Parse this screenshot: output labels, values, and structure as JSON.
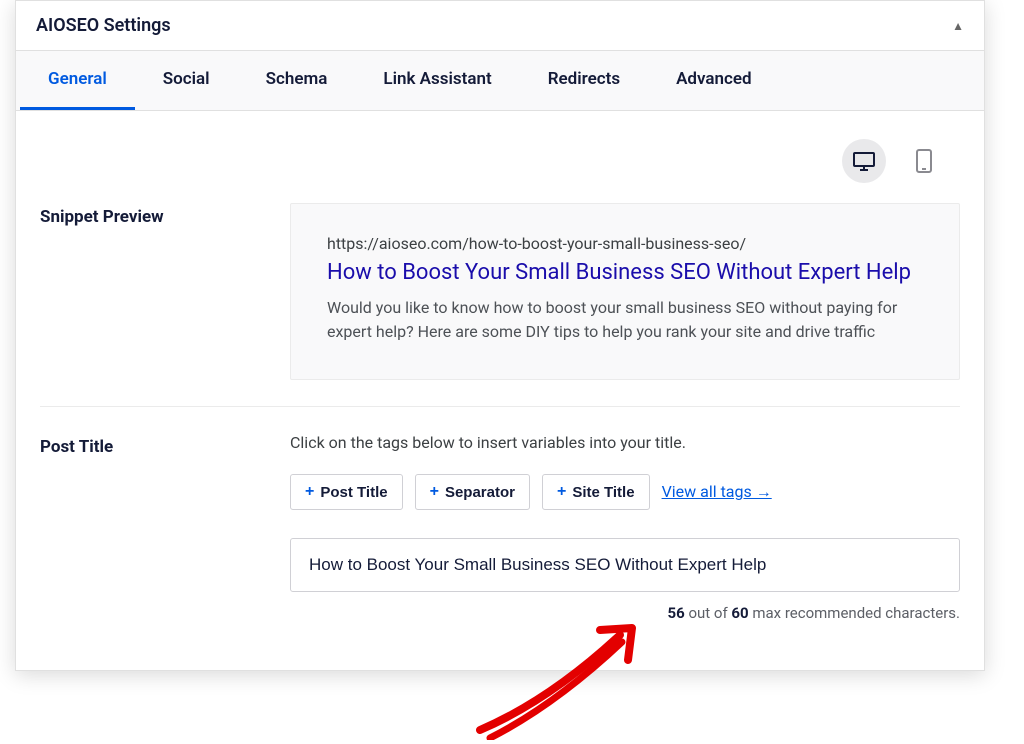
{
  "panel": {
    "title": "AIOSEO Settings"
  },
  "tabs": [
    {
      "label": "General",
      "active": true
    },
    {
      "label": "Social",
      "active": false
    },
    {
      "label": "Schema",
      "active": false
    },
    {
      "label": "Link Assistant",
      "active": false
    },
    {
      "label": "Redirects",
      "active": false
    },
    {
      "label": "Advanced",
      "active": false
    }
  ],
  "snippet": {
    "section_label": "Snippet Preview",
    "url": "https://aioseo.com/how-to-boost-your-small-business-seo/",
    "title": "How to Boost Your Small Business SEO Without Expert Help",
    "description": "Would you like to know how to boost your small business SEO without paying for expert help? Here are some DIY tips to help you rank your site and drive traffic"
  },
  "post_title": {
    "section_label": "Post Title",
    "help_text": "Click on the tags below to insert variables into your title.",
    "tags": {
      "post_title": "Post Title",
      "separator": "Separator",
      "site_title": "Site Title"
    },
    "view_all": "View all tags →",
    "input_value": "How to Boost Your Small Business SEO Without Expert Help",
    "char_count": {
      "current": "56",
      "mid": " out of ",
      "max": "60",
      "suffix": " max recommended characters."
    }
  }
}
